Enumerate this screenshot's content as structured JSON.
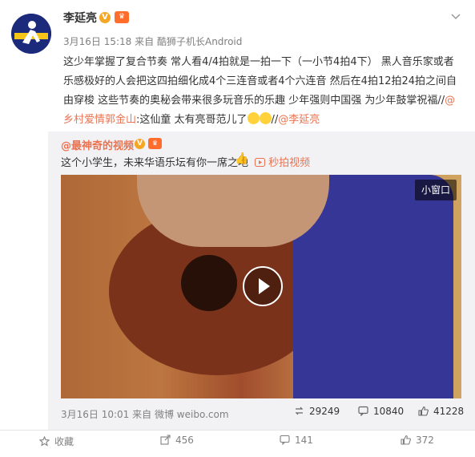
{
  "post": {
    "username": "李延亮",
    "verified_badge": "V",
    "vip_badge": "♛",
    "date": "3月16日 15:18",
    "source_prefix": "来自",
    "source": "酷狮子机长Android",
    "text_parts": [
      "这少年掌握了复合节奏 常人看4/4拍就是一拍一下（一小节4拍4下） 黑人音乐家或者乐感极好的人会把这四拍细化成4个三连音或者4个六连音 然后在4拍12拍24拍之间自由穿梭 这些节奏的奥秘会带来很多玩音乐的乐趣 少年强则中国强 为少年鼓掌祝福//",
      "@乡村爱情郭金山",
      ":这仙童 太有亮哥范儿了",
      "//",
      "@李延亮"
    ],
    "caret_icon": "chevron-down-icon"
  },
  "repost": {
    "username": "@最神奇的视频",
    "text": "这个小学生，未来华语乐坛有你一席之地",
    "video_link": "秒拍视频",
    "mini_window": "小窗口",
    "date": "3月16日 10:01",
    "source_prefix": "来自",
    "source": "微博 weibo.com",
    "reposts": "29249",
    "comments": "10840",
    "likes": "41228"
  },
  "actions": {
    "favorite": "收藏",
    "reposts": "456",
    "comments": "141",
    "likes": "372"
  },
  "colors": {
    "link": "#eb7350",
    "text": "#333333",
    "meta": "#808080",
    "repost_bg": "#f2f2f5"
  }
}
